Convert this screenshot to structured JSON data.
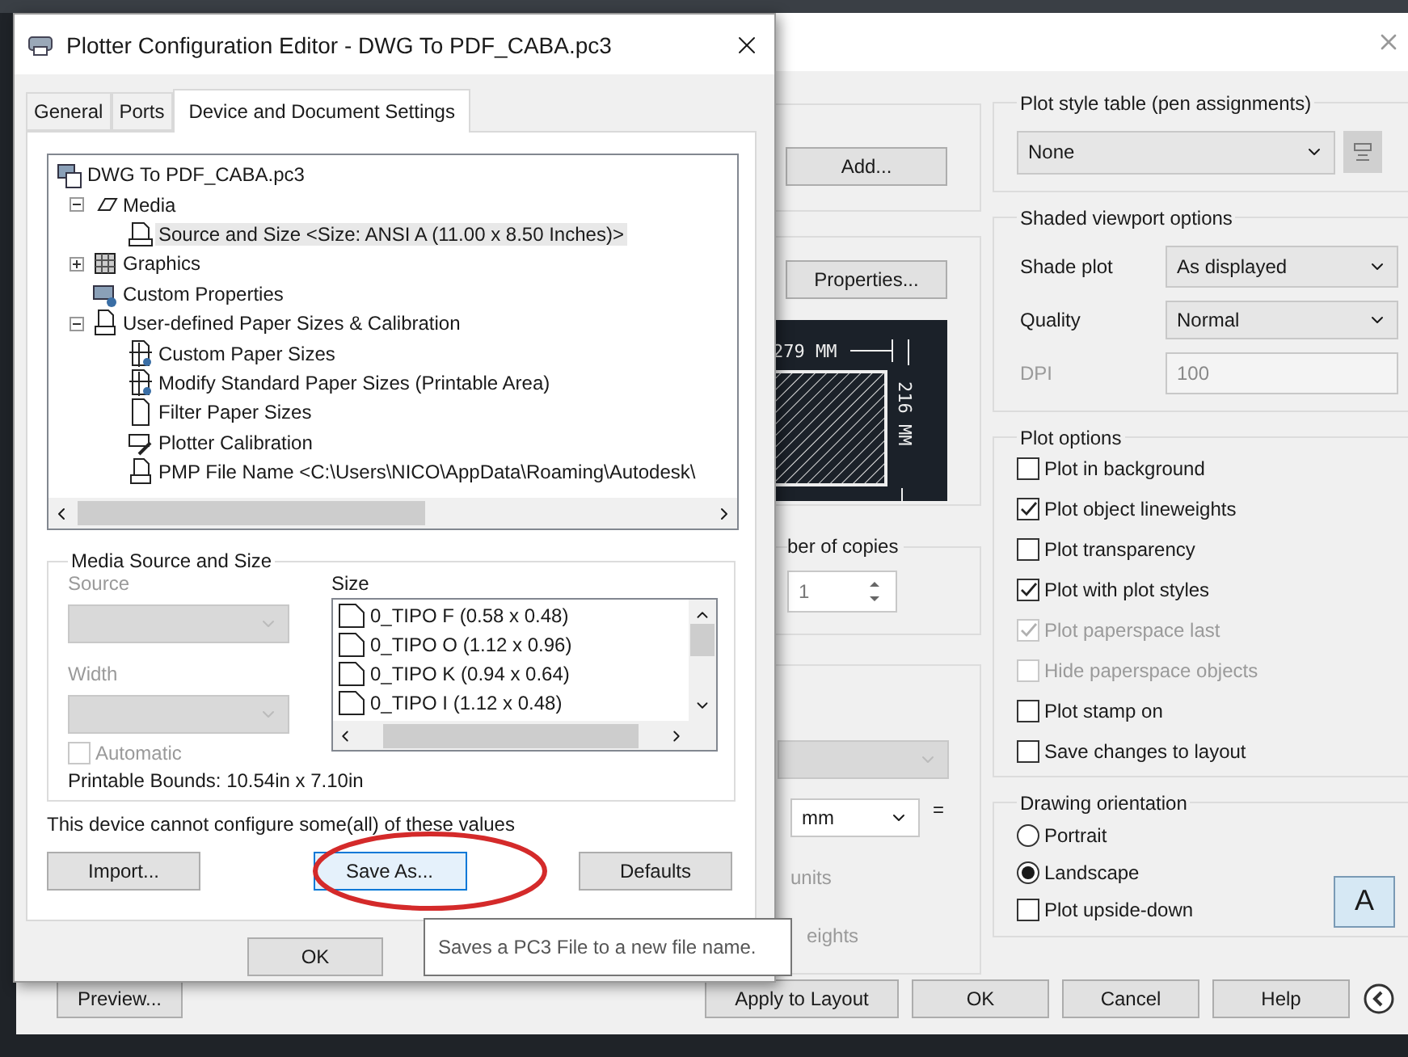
{
  "plot_dialog": {
    "middle": {
      "add_button": "Add...",
      "properties_button": "Properties...",
      "preview": {
        "width_label": "279 MM",
        "height_label": "216 MM"
      },
      "copies": {
        "label": "ber of copies",
        "value": "1"
      },
      "scale_select": {
        "disabled": true
      },
      "units_select": {
        "value": "mm"
      },
      "equals": "=",
      "units_label": "units",
      "lineweights_label": "eights"
    },
    "plot_style_table": {
      "title": "Plot style table (pen assignments)",
      "value": "None"
    },
    "shaded_viewport": {
      "title": "Shaded viewport options",
      "rows": [
        {
          "label": "Shade plot",
          "value": "As displayed",
          "kind": "select",
          "disabled": false
        },
        {
          "label": "Quality",
          "value": "Normal",
          "kind": "select",
          "disabled": false
        },
        {
          "label": "DPI",
          "value": "100",
          "kind": "input",
          "disabled": true
        }
      ]
    },
    "plot_options": {
      "title": "Plot options",
      "items": [
        {
          "label": "Plot in background",
          "checked": false,
          "disabled": false
        },
        {
          "label": "Plot object lineweights",
          "checked": true,
          "disabled": false
        },
        {
          "label": "Plot transparency",
          "checked": false,
          "disabled": false
        },
        {
          "label": "Plot with plot styles",
          "checked": true,
          "disabled": false
        },
        {
          "label": "Plot paperspace last",
          "checked": true,
          "disabled": true
        },
        {
          "label": "Hide paperspace objects",
          "checked": false,
          "disabled": true
        },
        {
          "label": "Plot stamp on",
          "checked": false,
          "disabled": false
        },
        {
          "label": "Save changes to layout",
          "checked": false,
          "disabled": false
        }
      ]
    },
    "orientation": {
      "title": "Drawing orientation",
      "options": [
        {
          "label": "Portrait",
          "selected": false
        },
        {
          "label": "Landscape",
          "selected": true
        }
      ],
      "upside_down": {
        "label": "Plot upside-down",
        "checked": false
      },
      "page_letter": "A"
    },
    "footer": {
      "preview_button": "Preview...",
      "buttons": [
        "Apply to Layout",
        "OK",
        "Cancel",
        "Help"
      ]
    }
  },
  "plotter_editor": {
    "title": "Plotter Configuration Editor - DWG To PDF_CABA.pc3",
    "tabs": [
      {
        "label": "General",
        "selected": false
      },
      {
        "label": "Ports",
        "selected": false
      },
      {
        "label": "Device and Document Settings",
        "selected": true
      }
    ],
    "tree": {
      "label": "DWG To PDF_CABA.pc3",
      "kind": "plotter",
      "selected": false,
      "children": [
        {
          "label": "Media",
          "kind": "media",
          "selected": false,
          "expanded": true,
          "children": [
            {
              "label": "Source and Size <Size: ANSI A (11.00 x 8.50 Inches)>",
              "kind": "tray",
              "selected": true
            }
          ]
        },
        {
          "label": "Graphics",
          "kind": "graphics",
          "selected": false,
          "expanded": false
        },
        {
          "label": "Custom Properties",
          "kind": "properties",
          "selected": false
        },
        {
          "label": "User-defined Paper Sizes & Calibration",
          "kind": "paper",
          "selected": false,
          "expanded": true,
          "children": [
            {
              "label": "Custom Paper Sizes",
              "kind": "custom",
              "selected": false
            },
            {
              "label": "Modify Standard Paper Sizes (Printable Area)",
              "kind": "custom",
              "selected": false
            },
            {
              "label": "Filter Paper Sizes",
              "kind": "sheet",
              "selected": false
            },
            {
              "label": "Plotter Calibration",
              "kind": "calibration",
              "selected": false
            },
            {
              "label": "PMP File Name <C:\\Users\\NICO\\AppData\\Roaming\\Autodesk\\",
              "kind": "paper",
              "selected": false
            }
          ]
        }
      ]
    },
    "media_group": {
      "title": "Media Source and Size",
      "source": {
        "label": "Source",
        "disabled": true
      },
      "width": {
        "label": "Width",
        "disabled": true
      },
      "size_label": "Size",
      "automatic": {
        "label": "Automatic",
        "checked": false,
        "disabled": true
      },
      "sizes": [
        {
          "label": "0_TIPO F (0.58 x 0.48)",
          "selected": false
        },
        {
          "label": "0_TIPO O (1.12 x 0.96)",
          "selected": false
        },
        {
          "label": "0_TIPO K (0.94 x 0.64)",
          "selected": false
        },
        {
          "label": "0_TIPO I (1.12 x 0.48)",
          "selected": false
        }
      ],
      "printable_bounds": "Printable Bounds: 10.54in x 7.10in"
    },
    "notice": "This device cannot configure some(all) of these values",
    "buttons": [
      {
        "label": "Import...",
        "focused": false,
        "circled": false
      },
      {
        "label": "Save As...",
        "focused": true,
        "circled": true
      },
      {
        "label": "Defaults",
        "focused": false,
        "circled": false
      }
    ],
    "ok_button": "OK",
    "tooltip": "Saves a PC3 File to a new file name."
  }
}
